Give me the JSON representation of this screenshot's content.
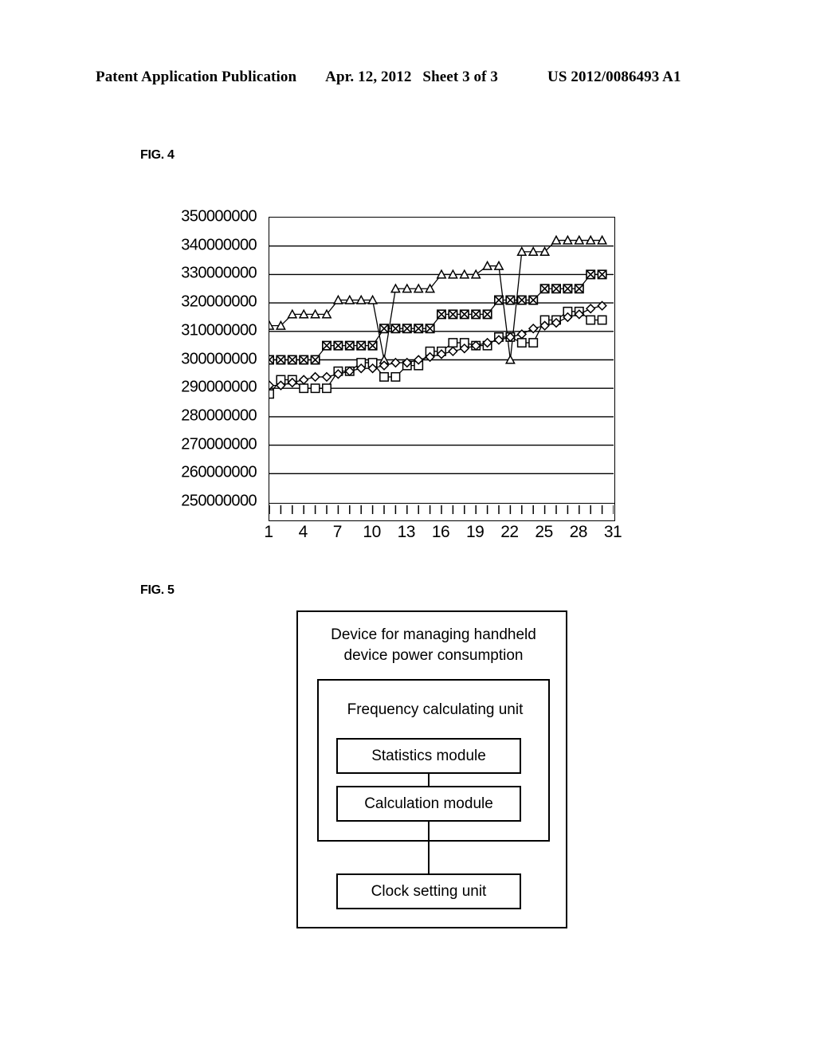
{
  "header": {
    "publication": "Patent Application Publication",
    "date": "Apr. 12, 2012",
    "sheet": "Sheet 3 of 3",
    "number": "US 2012/0086493 A1"
  },
  "figures": {
    "fig4_label": "FIG. 4",
    "fig5_label": "FIG. 5"
  },
  "chart_data": {
    "type": "line",
    "title": "FIG. 4",
    "xlabel": "",
    "ylabel": "",
    "xlim": [
      1,
      31
    ],
    "ylim": [
      250000000,
      350000000
    ],
    "grid": true,
    "legend": "none",
    "ytick_labels": [
      "350000000",
      "340000000",
      "330000000",
      "320000000",
      "310000000",
      "300000000",
      "290000000",
      "280000000",
      "270000000",
      "260000000",
      "250000000"
    ],
    "ytick_values": [
      350000000,
      340000000,
      330000000,
      320000000,
      310000000,
      300000000,
      290000000,
      280000000,
      270000000,
      260000000,
      250000000
    ],
    "xtick_labels": [
      "1",
      "4",
      "7",
      "10",
      "13",
      "16",
      "19",
      "22",
      "25",
      "28",
      "31"
    ],
    "xtick_values": [
      1,
      4,
      7,
      10,
      13,
      16,
      19,
      22,
      25,
      28,
      31
    ],
    "x": [
      1,
      2,
      3,
      4,
      5,
      6,
      7,
      8,
      9,
      10,
      11,
      12,
      13,
      14,
      15,
      16,
      17,
      18,
      19,
      20,
      21,
      22,
      23,
      24,
      25,
      26,
      27,
      28,
      29,
      30
    ],
    "series": [
      {
        "name": "series-triangle",
        "marker": "triangle",
        "values": [
          312000000,
          312000000,
          316000000,
          316000000,
          316000000,
          316000000,
          321000000,
          321000000,
          321000000,
          321000000,
          300000000,
          325000000,
          325000000,
          325000000,
          325000000,
          330000000,
          330000000,
          330000000,
          330000000,
          333000000,
          333000000,
          300000000,
          338000000,
          338000000,
          338000000,
          342000000,
          342000000,
          342000000,
          342000000,
          342000000
        ]
      },
      {
        "name": "series-crossed-square",
        "marker": "crossed-square",
        "values": [
          300000000,
          300000000,
          300000000,
          300000000,
          300000000,
          305000000,
          305000000,
          305000000,
          305000000,
          305000000,
          311000000,
          311000000,
          311000000,
          311000000,
          311000000,
          316000000,
          316000000,
          316000000,
          316000000,
          316000000,
          321000000,
          321000000,
          321000000,
          321000000,
          325000000,
          325000000,
          325000000,
          325000000,
          330000000,
          330000000
        ]
      },
      {
        "name": "series-open-square",
        "marker": "open-square",
        "values": [
          288000000,
          293000000,
          293000000,
          290000000,
          290000000,
          290000000,
          296000000,
          296000000,
          299000000,
          299000000,
          294000000,
          294000000,
          298000000,
          298000000,
          303000000,
          303000000,
          306000000,
          306000000,
          305000000,
          305000000,
          308000000,
          308000000,
          306000000,
          306000000,
          314000000,
          314000000,
          317000000,
          317000000,
          314000000,
          314000000
        ]
      },
      {
        "name": "series-diamond",
        "marker": "diamond",
        "values": [
          291000000,
          291000000,
          292000000,
          293000000,
          294000000,
          294000000,
          295000000,
          296000000,
          297000000,
          297000000,
          298000000,
          299000000,
          299000000,
          300000000,
          301000000,
          302000000,
          303000000,
          304000000,
          305000000,
          306000000,
          307000000,
          308000000,
          309000000,
          311000000,
          312000000,
          313000000,
          315000000,
          316000000,
          318000000,
          319000000
        ]
      }
    ]
  },
  "fig5": {
    "outer_title": "Device for managing handheld device power consumption",
    "frequency_unit": "Frequency calculating unit",
    "statistics_module": "Statistics module",
    "calculation_module": "Calculation module",
    "clock_setting_unit": "Clock setting unit"
  }
}
